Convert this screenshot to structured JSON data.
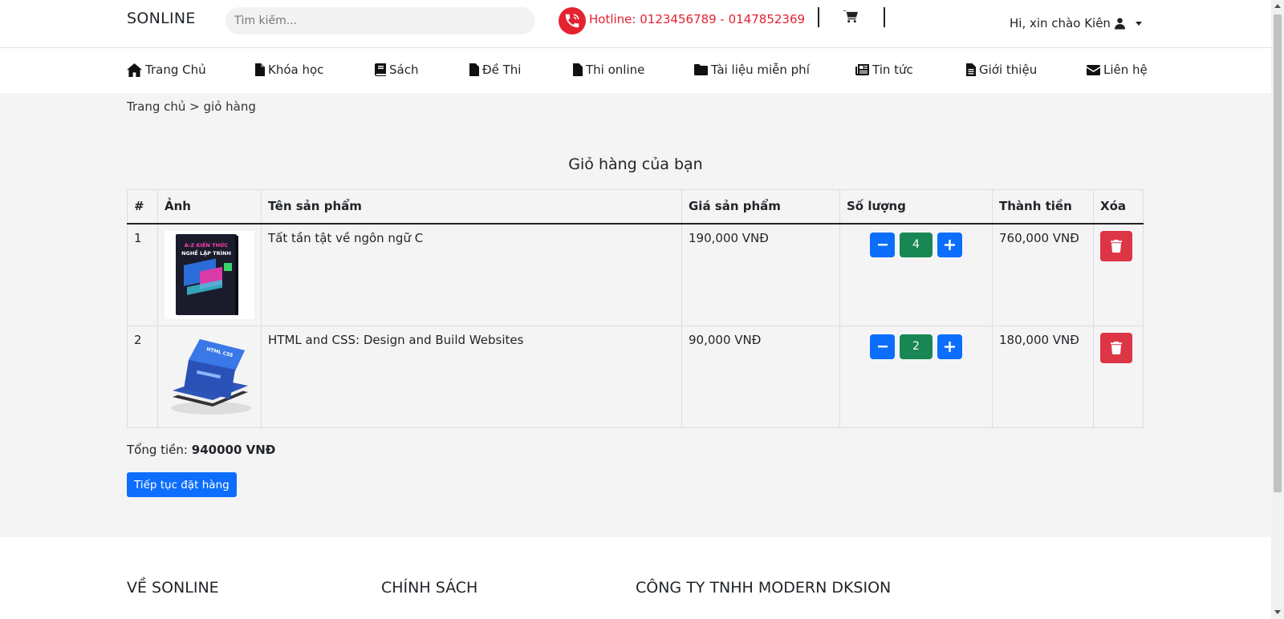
{
  "header": {
    "brand": "SONLINE",
    "search_placeholder": "Tìm kiếm...",
    "hotline": "Hotline: 0123456789 - 0147852369",
    "greeting": "Hi, xin chào Kiên"
  },
  "nav": {
    "items": [
      {
        "label": "Trang Chủ",
        "icon": "home-icon"
      },
      {
        "label": "Khóa học",
        "icon": "file-icon"
      },
      {
        "label": "Sách",
        "icon": "book-icon"
      },
      {
        "label": "Đề Thi",
        "icon": "file-icon"
      },
      {
        "label": "Thi online",
        "icon": "file-icon"
      },
      {
        "label": "Tài liệu miễn phí",
        "icon": "folder-icon"
      },
      {
        "label": "Tin tức",
        "icon": "newspaper-icon"
      },
      {
        "label": "Giới thiệu",
        "icon": "file-text-icon"
      },
      {
        "label": "Liên hệ",
        "icon": "envelope-icon"
      }
    ]
  },
  "breadcrumb": {
    "home": "Trang chủ",
    "separator": ">",
    "current": "giỏ hàng"
  },
  "cart": {
    "title": "Giỏ hàng của bạn",
    "columns": [
      "#",
      "Ảnh",
      "Tên sản phẩm",
      "Giá sản phẩm",
      "Số lượng",
      "Thành tiền",
      "Xóa"
    ],
    "rows": [
      {
        "index": "1",
        "name": "Tất tần tật về ngôn ngữ C",
        "price": "190,000 VNĐ",
        "qty": "4",
        "subtotal": "760,000 VNĐ",
        "image_text": "A-Z KIẾN THỨC NGHỀ LẬP TRÌNH"
      },
      {
        "index": "2",
        "name": "HTML and CSS: Design and Build Websites",
        "price": "90,000 VNĐ",
        "qty": "2",
        "subtotal": "180,000 VNĐ"
      }
    ],
    "total_label": "Tổng tiền:",
    "total_value": "940000 VNĐ",
    "order_button": "Tiếp tục đặt hàng"
  },
  "footer": {
    "headings": [
      "VỀ SONLINE",
      "CHÍNH SÁCH",
      "CÔNG TY TNHH MODERN DKSION"
    ]
  },
  "colors": {
    "primary": "#0d6efd",
    "success": "#198754",
    "danger": "#dc3545",
    "hotline": "#e52330",
    "page_bg": "#f4f4f4"
  }
}
